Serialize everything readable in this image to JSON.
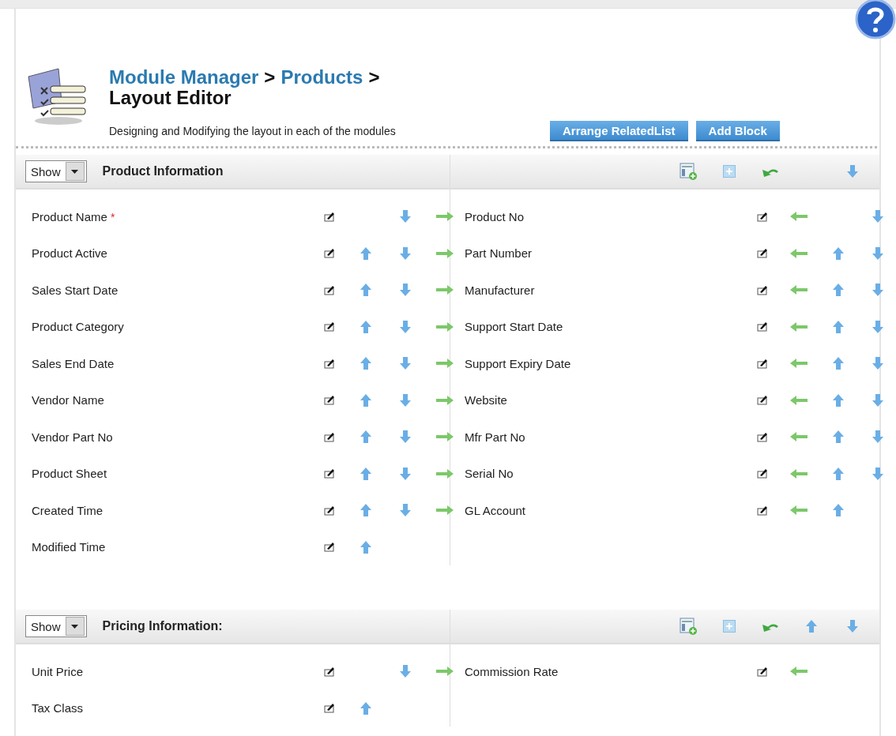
{
  "breadcrumb": [
    {
      "label": "Module Manager",
      "link": true
    },
    {
      "label": ">",
      "link": false
    },
    {
      "label": "Products",
      "link": true
    },
    {
      "label": ">",
      "link": false
    }
  ],
  "title": "Layout Editor",
  "description": "Designing and Modifying the layout in each of the modules",
  "buttons": [
    "Arrange RelatedList",
    "Add Block"
  ],
  "blocks": [
    {
      "show_label": "Show",
      "title": "Product Information",
      "tools": [
        {
          "kind": "add-field"
        },
        {
          "kind": "add-row"
        },
        {
          "kind": "undo"
        },
        {
          "kind": "down"
        }
      ],
      "columns": [
        [
          {
            "label": "Product Name",
            "required_mark": "*",
            "up": false,
            "down": true,
            "side": true
          },
          {
            "label": "Product Active",
            "up": true,
            "down": true,
            "side": true
          },
          {
            "label": "Sales Start Date",
            "up": true,
            "down": true,
            "side": true
          },
          {
            "label": "Product Category",
            "up": true,
            "down": true,
            "side": true
          },
          {
            "label": "Sales End Date",
            "up": true,
            "down": true,
            "side": true
          },
          {
            "label": "Vendor Name",
            "up": true,
            "down": true,
            "side": true
          },
          {
            "label": "Vendor Part No",
            "up": true,
            "down": true,
            "side": true
          },
          {
            "label": "Product Sheet",
            "up": true,
            "down": true,
            "side": true
          },
          {
            "label": "Created Time",
            "up": true,
            "down": true,
            "side": true
          },
          {
            "label": "Modified Time",
            "up": true,
            "down": false,
            "side": false
          }
        ],
        [
          {
            "label": "Product No",
            "up": false,
            "down": true,
            "side": true
          },
          {
            "label": "Part Number",
            "up": true,
            "down": true,
            "side": true
          },
          {
            "label": "Manufacturer",
            "up": true,
            "down": true,
            "side": true
          },
          {
            "label": "Support Start Date",
            "up": true,
            "down": true,
            "side": true
          },
          {
            "label": "Support Expiry Date",
            "up": true,
            "down": true,
            "side": true
          },
          {
            "label": "Website",
            "up": true,
            "down": true,
            "side": true
          },
          {
            "label": "Mfr Part No",
            "up": true,
            "down": true,
            "side": true
          },
          {
            "label": "Serial No",
            "up": true,
            "down": true,
            "side": true
          },
          {
            "label": "GL Account",
            "up": true,
            "down": false,
            "side": true
          }
        ]
      ]
    },
    {
      "show_label": "Show",
      "title": "Pricing Information:",
      "tools": [
        {
          "kind": "add-field"
        },
        {
          "kind": "add-row"
        },
        {
          "kind": "undo"
        },
        {
          "kind": "up"
        },
        {
          "kind": "down"
        }
      ],
      "columns": [
        [
          {
            "label": "Unit Price",
            "up": false,
            "down": true,
            "side": true
          },
          {
            "label": "Tax Class",
            "up": true,
            "down": false,
            "side": false
          }
        ],
        [
          {
            "label": "Commission Rate",
            "up": false,
            "down": false,
            "side": true
          }
        ]
      ]
    }
  ]
}
